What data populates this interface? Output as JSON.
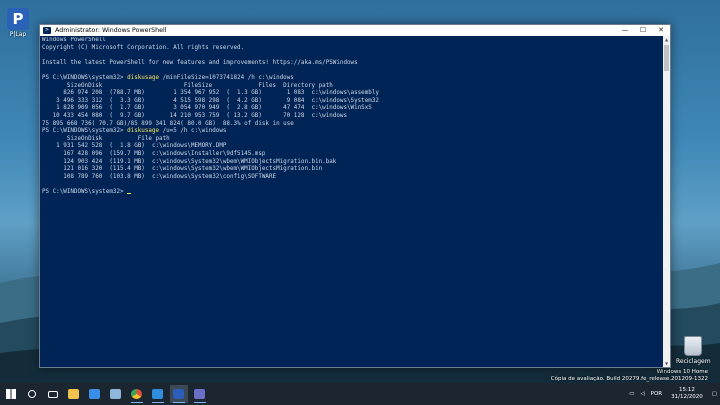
{
  "desktop": {
    "top_icon_label": "P|Lap",
    "recycle_label": "Reciclagem",
    "watermark": {
      "line1": "Windows 10 Home",
      "line2": "Cópia de avaliação. Build 20279.fe_release.201209-1322"
    }
  },
  "window": {
    "title": "Administrator: Windows PowerShell",
    "controls": {
      "minimize": "—",
      "maximize": "☐",
      "close": "✕"
    }
  },
  "console": {
    "lines": [
      {
        "pre": "Windows PowerShell"
      },
      {
        "pre": "Copyright (C) Microsoft Corporation. All rights reserved."
      },
      {
        "pre": ""
      },
      {
        "pre": "Install the latest PowerShell for new features and improvements! https://aka.ms/PSWindows"
      },
      {
        "pre": ""
      },
      {
        "pre": "PS C:\\WINDOWS\\system32> ",
        "cmd": "diskusage",
        "post": " /minFileSize=1073741824 /h c:\\windows"
      },
      {
        "pre": "       SizeOnDisk                       FileSize             Files  Directory path"
      },
      {
        "pre": "      826 974 208  (788.7 MB)        1 354 967 952  (  1.3 GB)       1 083  c:\\windows\\assembly"
      },
      {
        "pre": "    3 496 333 312  (  3.3 GB)        4 515 598 298  (  4.2 GB)       9 084  c:\\windows\\System32"
      },
      {
        "pre": "    1 828 909 056  (  1.7 GB)        3 054 970 949  (  2.8 GB)      47 474  c:\\windows\\WinSxS"
      },
      {
        "pre": "   10 433 454 080  (  9.7 GB)       14 210 953 759  ( 13.2 GB)      70 128  c:\\windows"
      },
      {
        "pre": "75 895 668 736( 70.7 GB)/85 899 341 824( 80.0 GB)  88.3% of disk in use"
      },
      {
        "pre": "PS C:\\WINDOWS\\system32> ",
        "cmd": "diskusage",
        "post": " /u=5 /h c:\\windows"
      },
      {
        "pre": "       SizeOnDisk          File path"
      },
      {
        "pre": "    1 931 542 528  (  1.8 GB)  c:\\windows\\MEMORY.DMP"
      },
      {
        "pre": "      167 428 096  (159.7 MB)  c:\\windows\\Installer\\9df5145.msp"
      },
      {
        "pre": "      124 903 424  (119.1 MB)  c:\\windows\\System32\\wbem\\WMIObjectsMigration.bin.bak"
      },
      {
        "pre": "      121 016 320  (115.4 MB)  c:\\windows\\System32\\wbem\\WMIObjectsMigration.bin"
      },
      {
        "pre": "      108 789 760  (103.8 MB)  c:\\windows\\System32\\config\\SOFTWARE"
      },
      {
        "pre": ""
      },
      {
        "pre": "PS C:\\WINDOWS\\system32> ",
        "cursor": true
      }
    ]
  },
  "taskbar": {
    "icons": [
      {
        "name": "start-icon",
        "color": "#ffffff"
      },
      {
        "name": "search-icon",
        "color": "#ffffff"
      },
      {
        "name": "task-view-icon",
        "color": "#ffffff"
      },
      {
        "name": "file-explorer-icon",
        "color": "#f2c14e"
      },
      {
        "name": "store-icon",
        "color": "#3a8ee6"
      },
      {
        "name": "notepad-icon",
        "color": "#8fb7d9"
      },
      {
        "name": "chrome-icon",
        "color": "#e34b3b"
      },
      {
        "name": "vscode-icon",
        "color": "#2f8ee0"
      },
      {
        "name": "powershell-icon",
        "color": "#2c5db8"
      },
      {
        "name": "teams-icon",
        "color": "#6b6fc8"
      }
    ],
    "language": "POR",
    "time": "15:12",
    "date": "31/12/2020"
  }
}
